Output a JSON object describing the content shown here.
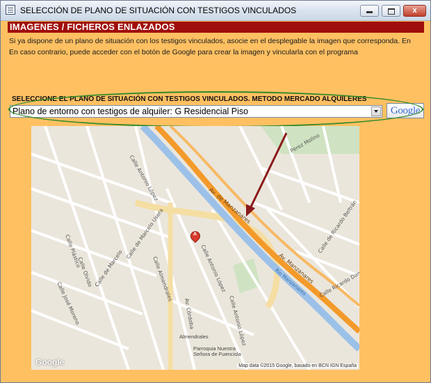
{
  "window": {
    "title": "SELECCIÓN DE PLANO DE SITUACIÓN CON TESTIGOS VINCULADOS",
    "controls": {
      "minimize": "",
      "maximize": "",
      "close": "x"
    }
  },
  "header": {
    "title": "IMAGENES / FICHEROS ENLAZADOS"
  },
  "info": {
    "line1": "Si ya dispone de un plano de situación con los testigos vinculados, asocie en el desplegable la imagen que corresponda. En",
    "line2": "En caso contrario, puede acceder con el botón de Google para crear la imagen y vincularla con el programa"
  },
  "selector": {
    "label": "SELECCIONE EL PLANO DE SITUACIÓN CON TESTIGOS VINCULADOS. METODO MERCADO ALQUILERES",
    "value": "Plano de entorno con testigos de alquiler: G Residencial Piso"
  },
  "google_button": {
    "label": "Google"
  },
  "map": {
    "marker_label": "A",
    "streets": {
      "antonio_lopez_top": "Calle Antonio López",
      "antonio_lopez_mid": "Calle Antonio López",
      "marcelo_usera": "Calle de Marcelo Usera",
      "av_cordoba": "Av. Córdoba",
      "manzanares_1": "Av. de Manzanares",
      "manzanares_2": "Av. Manzanares",
      "ricardo_damas": "Calle Ricardo Damas",
      "ricardo_beltran": "Calle de Ricardo Beltrán",
      "jose_moreno": "Calle José Moreno",
      "marcelo_mid": "Calle de Marcelo",
      "perez_molino": "Pérez Molino",
      "plastico": "Calle Plástico",
      "olvido": "Calle Olvido",
      "almendrales": "Calle Almendrales",
      "antonio_lopez_b": "Calle Antonio López"
    },
    "river": "Río Manzanares",
    "poi": {
      "almendrales": "Almendrales",
      "parroquia": "Parroquia Nuestra Señora de Fuencisla"
    },
    "logo": "Google",
    "attribution": "Map data ©2015 Google, basado en BCN IGN España"
  },
  "colors": {
    "window_bg": "#ffc062",
    "header_bg": "#a00d0d",
    "ellipse": "#2f8a2a",
    "arrow": "#8b1a1a",
    "highway": "#f39a2a",
    "river": "#9cc1e8",
    "marker": "#d93a2b"
  }
}
